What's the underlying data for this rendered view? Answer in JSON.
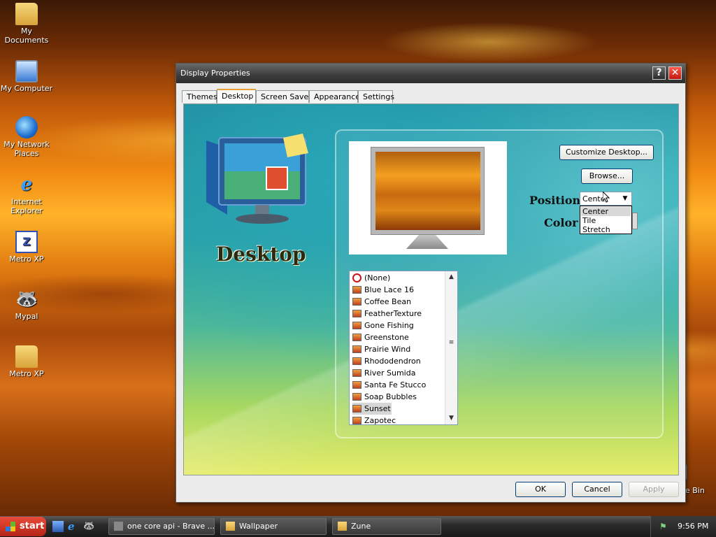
{
  "desktop": {
    "icons": [
      {
        "label": "My Documents",
        "icon": "folder-icon"
      },
      {
        "label": "My Computer",
        "icon": "computer-icon"
      },
      {
        "label": "My Network Places",
        "icon": "network-icon"
      },
      {
        "label": "Internet Explorer",
        "icon": "ie-icon"
      },
      {
        "label": "Metro XP",
        "icon": "zip-folder-icon"
      },
      {
        "label": "Mypal",
        "icon": "raccoon-icon"
      },
      {
        "label": "Metro XP",
        "icon": "folder-icon"
      }
    ],
    "recycle_bin_label": "e Bin"
  },
  "window": {
    "title": "Display Properties",
    "help_label": "?",
    "close_label": "✕",
    "tabs": [
      {
        "label": "Themes",
        "active": false
      },
      {
        "label": "Desktop",
        "active": true
      },
      {
        "label": "Screen Saver",
        "active": false
      },
      {
        "label": "Appearance",
        "active": false
      },
      {
        "label": "Settings",
        "active": false
      }
    ],
    "desktop_heading": "Desktop",
    "customize_label": "Customize Desktop...",
    "browse_label": "Browse...",
    "position_label": "Position :",
    "color_label": "Color :",
    "position_value": "Center",
    "position_options": [
      "Center",
      "Tile",
      "Stretch"
    ],
    "background_list": [
      {
        "label": "(None)",
        "kind": "none"
      },
      {
        "label": "Blue Lace 16"
      },
      {
        "label": "Coffee Bean"
      },
      {
        "label": "FeatherTexture"
      },
      {
        "label": "Gone Fishing"
      },
      {
        "label": "Greenstone"
      },
      {
        "label": "Prairie Wind"
      },
      {
        "label": "Rhododendron"
      },
      {
        "label": "River Sumida"
      },
      {
        "label": "Santa Fe Stucco"
      },
      {
        "label": "Soap Bubbles"
      },
      {
        "label": "Sunset",
        "selected": true
      },
      {
        "label": "Zapotec"
      }
    ],
    "buttons": {
      "ok": "OK",
      "cancel": "Cancel",
      "apply": "Apply"
    }
  },
  "taskbar": {
    "start_label": "start",
    "tasks": [
      {
        "label": "one core api - Brave ..."
      },
      {
        "label": "Wallpaper"
      },
      {
        "label": "Zune"
      }
    ],
    "clock": "9:56 PM"
  },
  "colors": {
    "accent_tab": "#e8a030",
    "close": "#c0190d",
    "taskbar": "#2c2c2c"
  }
}
